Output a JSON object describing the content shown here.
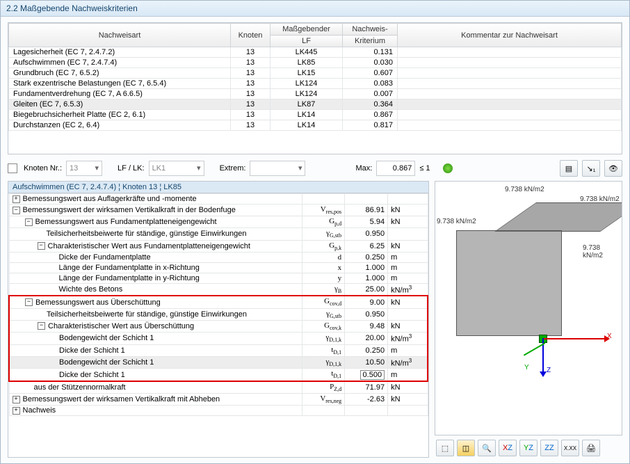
{
  "title": "2.2 Maßgebende Nachweiskriterien",
  "headers": {
    "col_art": "Nachweisart",
    "col_knoten": "Knoten",
    "col_lf_group": "Maßgebender",
    "col_lf": "LF",
    "col_krit_group": "Nachweis-",
    "col_krit": "Kriterium",
    "col_komm": "Kommentar zur Nachweisart"
  },
  "rows": [
    {
      "art": "Lagesicherheit (EC 7, 2.4.7.2)",
      "knoten": "13",
      "lf": "LK445",
      "k": "0.131"
    },
    {
      "art": "Aufschwimmen (EC 7, 2.4.7.4)",
      "knoten": "13",
      "lf": "LK85",
      "k": "0.030"
    },
    {
      "art": "Grundbruch (EC 7, 6.5.2)",
      "knoten": "13",
      "lf": "LK15",
      "k": "0.607"
    },
    {
      "art": "Stark exzentrische Belastungen (EC 7, 6.5.4)",
      "knoten": "13",
      "lf": "LK124",
      "k": "0.083"
    },
    {
      "art": "Fundamentverdrehung (EC 7, A 6.6.5)",
      "knoten": "13",
      "lf": "LK124",
      "k": "0.007"
    },
    {
      "art": "Gleiten (EC 7, 6.5.3)",
      "knoten": "13",
      "lf": "LK87",
      "k": "0.364"
    },
    {
      "art": "Biegebruchsicherheit Platte (EC 2, 6.1)",
      "knoten": "13",
      "lf": "LK14",
      "k": "0.867"
    },
    {
      "art": "Durchstanzen (EC 2, 6.4)",
      "knoten": "13",
      "lf": "LK14",
      "k": "0.817"
    }
  ],
  "filter": {
    "knoten_lbl": "Knoten Nr.:",
    "knoten_val": "13",
    "lflk_lbl": "LF / LK:",
    "lflk_val": "LK1",
    "extrem_lbl": "Extrem:",
    "extrem_val": "",
    "max_lbl": "Max:",
    "max_val": "0.867",
    "max_cond": "≤ 1"
  },
  "detail_title": "Aufschwimmen (EC 7, 2.4.7.4) ¦ Knoten 13 ¦ LK85",
  "details": [
    {
      "i": 0,
      "t": "+",
      "l": "Bemessungswert aus Auflagerkräfte und -momente",
      "s": "",
      "v": "",
      "u": ""
    },
    {
      "i": 0,
      "t": "-",
      "l": "Bemessungswert der wirksamen Vertikalkraft in der Bodenfuge",
      "s": "V<sub>res,pos</sub>",
      "v": "86.91",
      "u": "kN"
    },
    {
      "i": 1,
      "t": "-",
      "l": "Bemessungswert aus Fundamentplatteneigengewicht",
      "s": "G<sub>p,d</sub>",
      "v": "5.94",
      "u": "kN"
    },
    {
      "i": 2,
      "t": "",
      "l": "Teilsicherheitsbeiwerte für ständige, günstige Einwirkungen",
      "s": "γ<sub>G,stb</sub>",
      "v": "0.950",
      "u": ""
    },
    {
      "i": 2,
      "t": "-",
      "l": "Charakteristischer Wert aus Fundamentplatteneigengewicht",
      "s": "G<sub>p,k</sub>",
      "v": "6.25",
      "u": "kN"
    },
    {
      "i": 3,
      "t": "",
      "l": "Dicke der Fundamentplatte",
      "s": "d",
      "v": "0.250",
      "u": "m"
    },
    {
      "i": 3,
      "t": "",
      "l": "Länge der Fundamentplatte in x-Richtung",
      "s": "x",
      "v": "1.000",
      "u": "m"
    },
    {
      "i": 3,
      "t": "",
      "l": "Länge der Fundamentplatte in y-Richtung",
      "s": "y",
      "v": "1.000",
      "u": "m"
    },
    {
      "i": 3,
      "t": "",
      "l": "Wichte des Betons",
      "s": "γ<sub>B</sub>",
      "v": "25.00",
      "u": "kN/m<sup>3</sup>"
    },
    {
      "i": 1,
      "t": "-",
      "l": "Bemessungswert aus Überschüttung",
      "s": "G<sub>cov,d</sub>",
      "v": "9.00",
      "u": "kN",
      "red": "start"
    },
    {
      "i": 2,
      "t": "",
      "l": "Teilsicherheitsbeiwerte für ständige, günstige Einwirkungen",
      "s": "γ<sub>G,stb</sub>",
      "v": "0.950",
      "u": ""
    },
    {
      "i": 2,
      "t": "-",
      "l": "Charakteristischer Wert aus Überschüttung",
      "s": "G<sub>cov,k</sub>",
      "v": "9.48",
      "u": "kN"
    },
    {
      "i": 3,
      "t": "",
      "l": "Bodengewicht der Schicht 1",
      "s": "γ<sub>D,1,k</sub>",
      "v": "20.00",
      "u": "kN/m<sup>3</sup>"
    },
    {
      "i": 3,
      "t": "",
      "l": "Dicke der Schicht 1",
      "s": "t<sub>D,1</sub>",
      "v": "0.250",
      "u": "m"
    },
    {
      "i": 3,
      "t": "",
      "l": "Bodengewicht der Schicht 1",
      "s": "γ<sub>D,1,k</sub>",
      "v": "10.50",
      "u": "kN/m<sup>3</sup>",
      "sel": true
    },
    {
      "i": 3,
      "t": "",
      "l": "Dicke der Schicht 1",
      "s": "t<sub>D,1</sub>",
      "v": "0.500",
      "u": "m",
      "red": "end",
      "box": true
    },
    {
      "i": 1,
      "t": "",
      "l": "aus der Stützennormalkraft",
      "s": "P<sub>Z,d</sub>",
      "v": "71.97",
      "u": "kN"
    },
    {
      "i": 0,
      "t": "+",
      "l": "Bemessungswert der wirksamen Vertikalkraft mit Abheben",
      "s": "V<sub>res,neg</sub>",
      "v": "-2.63",
      "u": "kN"
    },
    {
      "i": 0,
      "t": "+",
      "l": "Nachweis",
      "s": "",
      "v": "",
      "u": ""
    }
  ],
  "view": {
    "label": "9.738 kN/m2",
    "ax_x": "X",
    "ax_y": "Y",
    "ax_z": "Z"
  },
  "tools": [
    "view-iso",
    "view-box",
    "view-find",
    "view-xz",
    "view-yz",
    "view-zz1",
    "view-xxx",
    "view-print"
  ]
}
